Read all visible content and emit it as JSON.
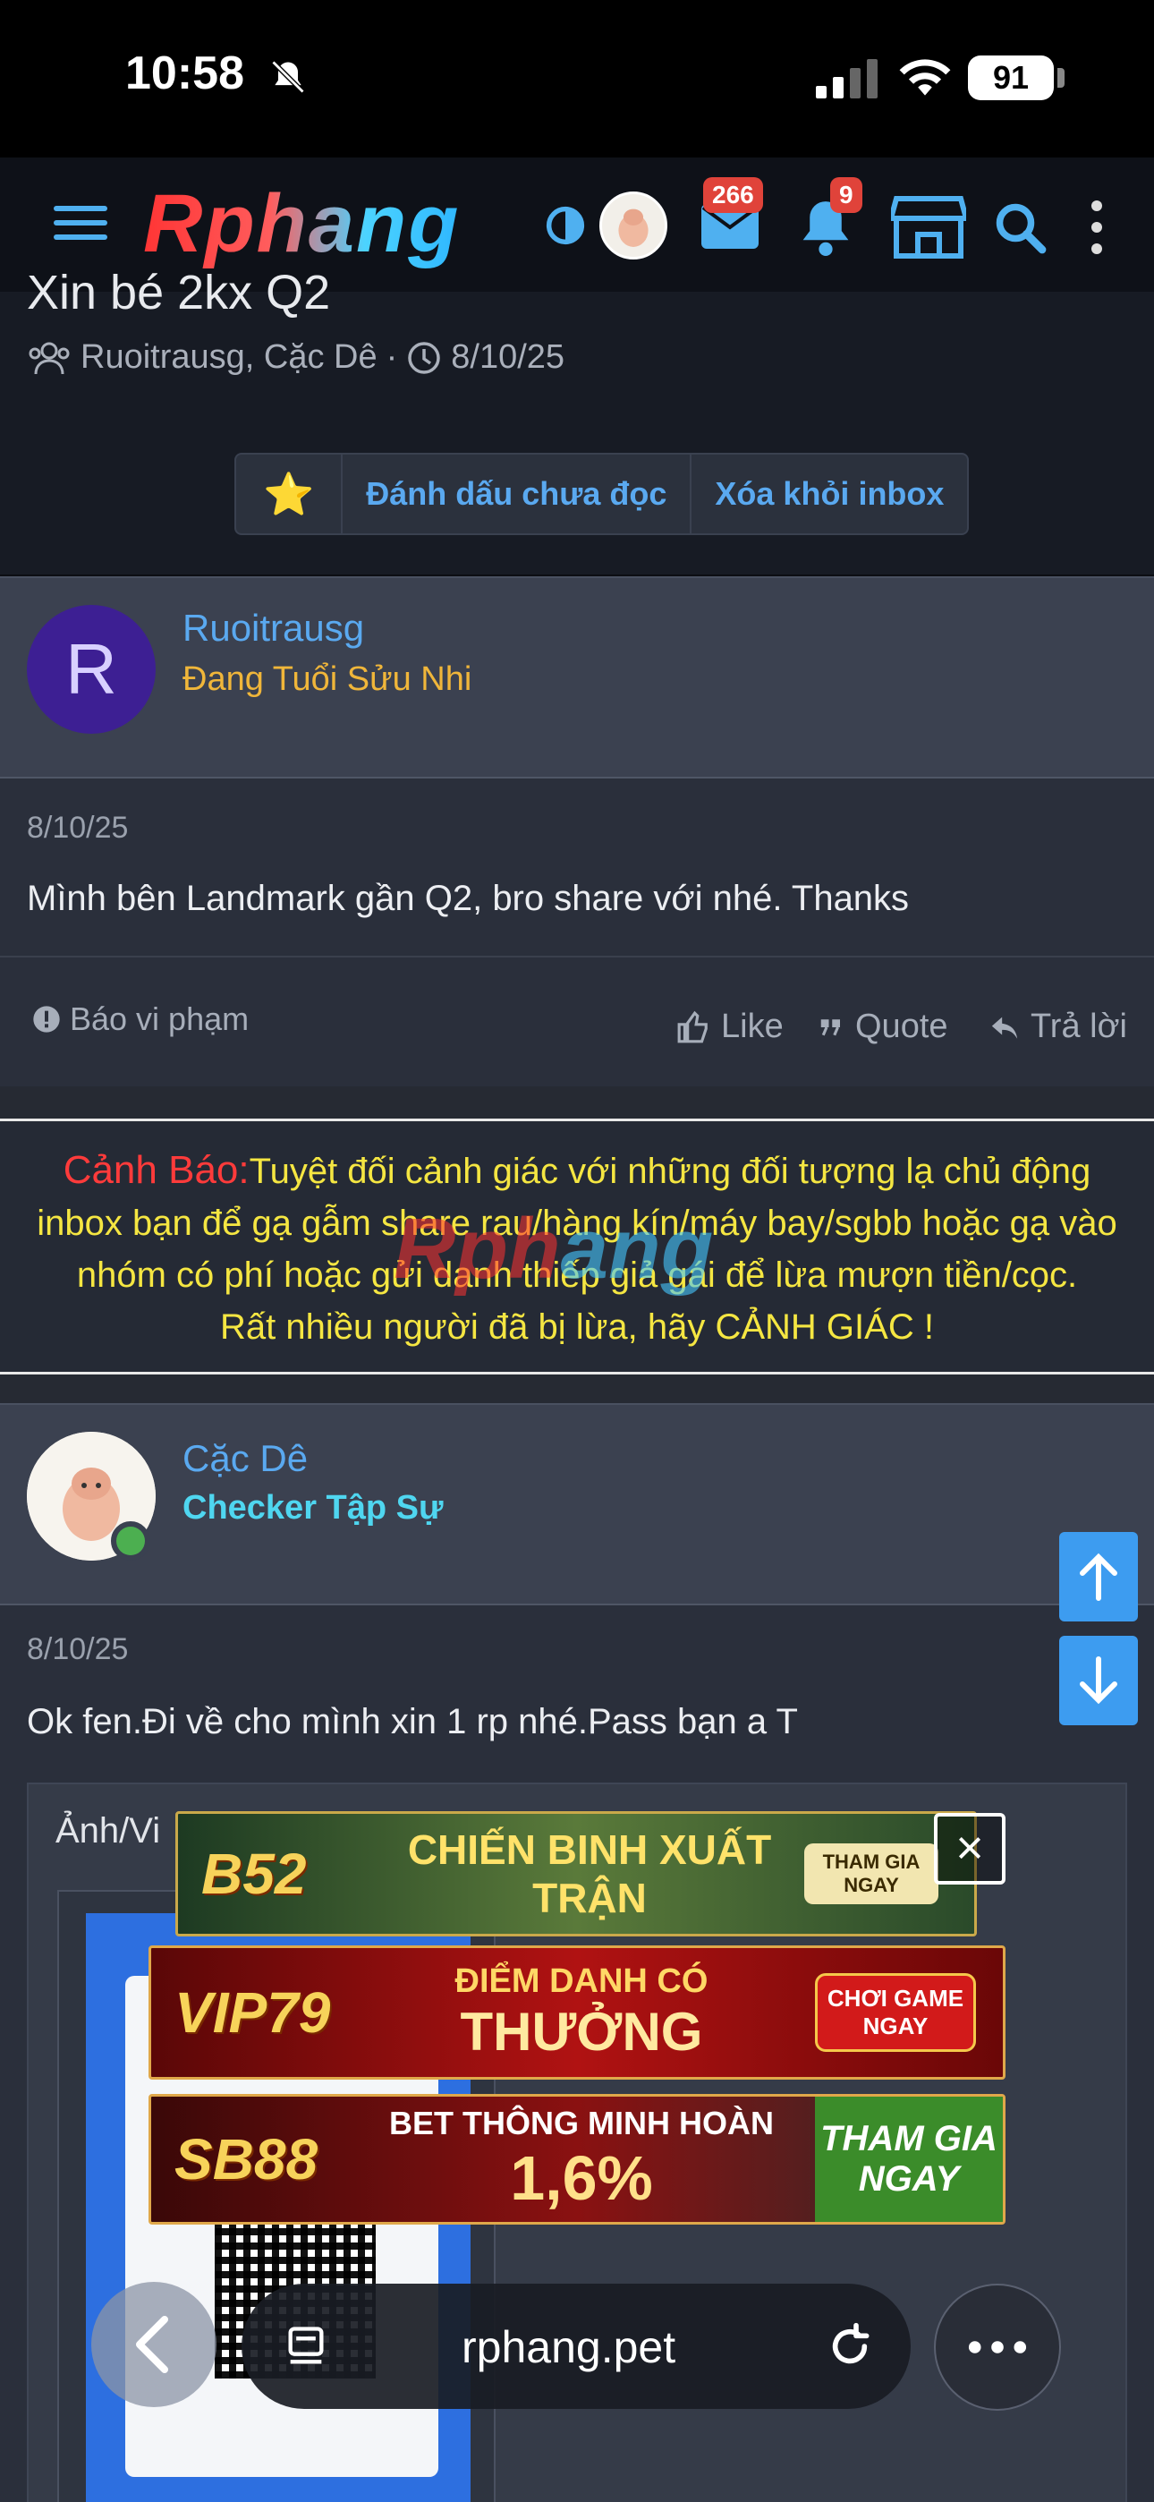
{
  "status_bar": {
    "time": "10:58",
    "battery": "91"
  },
  "header": {
    "logo": "Rphang",
    "mail_badge": "266",
    "bell_badge": "9"
  },
  "thread": {
    "title": "Xin bé 2kx Q2",
    "meta_users": "Ruoitrausg, Cặc Dê",
    "meta_date": "8/10/25",
    "actions": {
      "star": "⭐",
      "mark_unread": "Đánh dấu chưa đọc",
      "remove_inbox": "Xóa khỏi inbox"
    }
  },
  "post1": {
    "avatar_letter": "R",
    "username": "Ruoitrausg",
    "user_title": "Đang Tuổi Sửu Nhi",
    "date": "8/10/25",
    "text": "Mình bên Landmark gần Q2, bro share với nhé. Thanks",
    "report": "Báo vi phạm",
    "like": "Like",
    "quote": "Quote",
    "reply": "Trả lời"
  },
  "warning": {
    "label": "Cảnh Báo:",
    "line1": "Tuyệt đối cảnh giác với những đối tượng lạ chủ động",
    "line2": "inbox bạn để gạ gẫm share rau/hàng kín/máy bay/sgbb hoặc gạ vào",
    "line3": "nhóm có phí hoặc gửi danh thiếp giả gái để lừa mượn tiền/cọc.",
    "line4": "Rất nhiều người đã bị lừa, hãy CẢNH GIÁC !",
    "watermark_red": "Rph",
    "watermark_blue": "ang"
  },
  "post2": {
    "username": "Cặc Dê",
    "user_title": "Checker Tập Sự",
    "date": "8/10/25",
    "text": "Ok fen.Đi về cho mình xin 1 rp nhé.Pass bạn a T",
    "attach_label": "Ảnh/Vi"
  },
  "ads": {
    "ad1_brand": "B52",
    "ad1_text": "CHIẾN BINH XUẤT TRẬN",
    "ad1_cta": "THAM GIA NGAY",
    "ad2_brand": "VIP79",
    "ad2_text_top": "ĐIỂM DANH CÓ",
    "ad2_text_bottom": "THƯỞNG",
    "ad2_cta": "CHƠI GAME NGAY",
    "ad3_brand": "SB88",
    "ad3_text_top": "BET THÔNG MINH HOÀN",
    "ad3_text_bottom": "1,6%",
    "ad3_cta": "THAM GIA NGAY",
    "close": "×"
  },
  "browser": {
    "url": "rphang.pet"
  },
  "colors": {
    "accent": "#5aa9f0",
    "warning_text": "#f5e642",
    "warning_label": "#ff3b3b",
    "title_gold": "#f0b63a",
    "title_cyan": "#4fd6f0"
  }
}
